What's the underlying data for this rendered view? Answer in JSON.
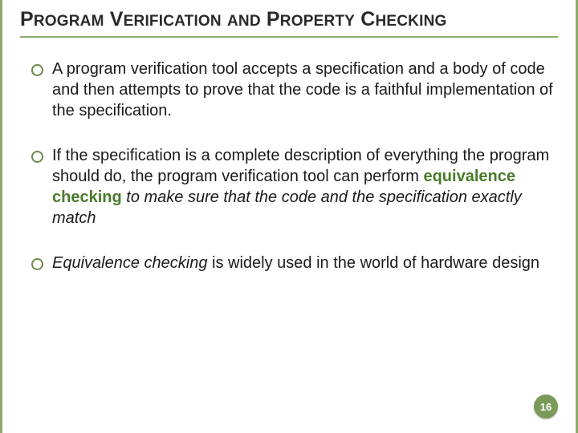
{
  "title": {
    "w1_first": "P",
    "w1_rest": "ROGRAM",
    "w2_first": "V",
    "w2_rest": "ERIFICATION",
    "w3": "AND",
    "w4_first": "P",
    "w4_rest": "ROPERTY",
    "w5_first": "C",
    "w5_rest": "HECKING"
  },
  "bullets": {
    "b1": "A program verification tool accepts a specification and a body of code and then attempts to prove that the code is a faithful implementation of the specification.",
    "b2_pre": "If the specification is a complete description of everything the program should do, the program verification tool can perform ",
    "b2_bold": "equivalence checking",
    "b2_post_italic": " to make sure that the code and the specification exactly match",
    "b3_italic": "Equivalence checking",
    "b3_rest": " is widely used in the world of hardware design"
  },
  "page_number": "16"
}
